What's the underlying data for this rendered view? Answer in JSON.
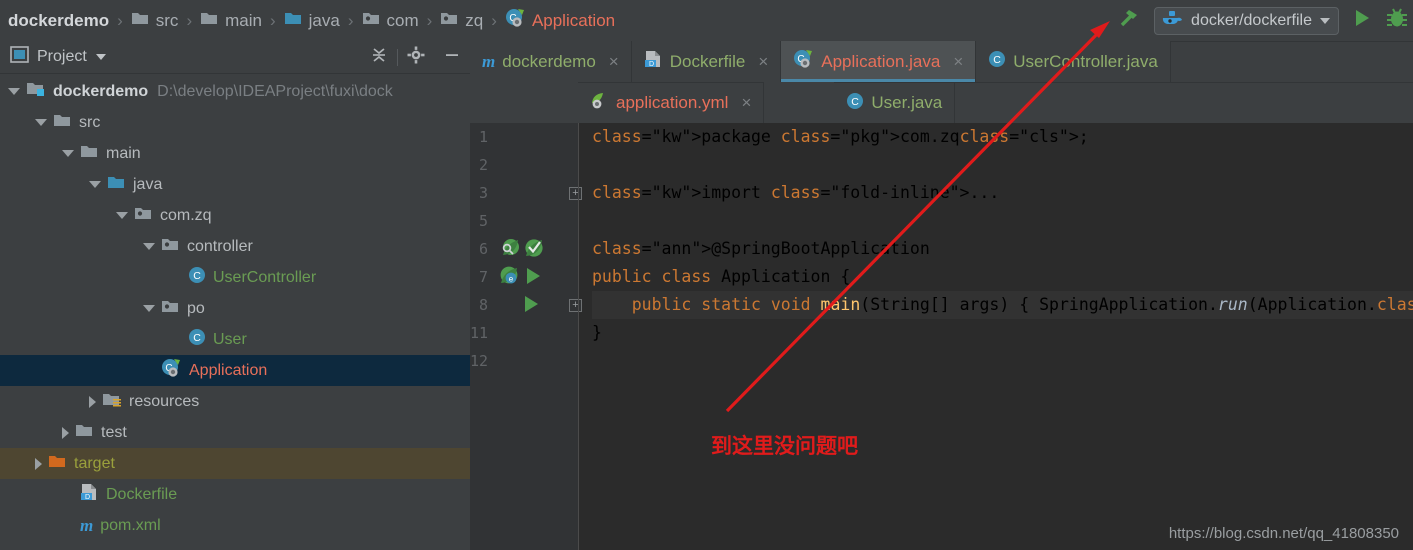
{
  "breadcrumb": {
    "items": [
      {
        "label": "dockerdemo",
        "icon": "none",
        "style": "root"
      },
      {
        "label": "src",
        "icon": "folder-grey",
        "style": "plain"
      },
      {
        "label": "main",
        "icon": "folder-grey",
        "style": "plain"
      },
      {
        "label": "java",
        "icon": "folder-blue",
        "style": "plain"
      },
      {
        "label": "com",
        "icon": "package",
        "style": "plain"
      },
      {
        "label": "zq",
        "icon": "package",
        "style": "plain"
      },
      {
        "label": "Application",
        "icon": "spring-class",
        "style": "leaf"
      }
    ],
    "separator": "›"
  },
  "toolbar": {
    "build_icon": "hammer-icon",
    "run_config": {
      "icon": "docker-whale-icon",
      "label": "docker/dockerfile",
      "caret": "▼"
    },
    "run_icon": "run-icon",
    "debug_icon": "debug-icon"
  },
  "sidebar": {
    "title": "Project",
    "title_icon": "project-view-icon",
    "caret": "▼",
    "actions": [
      {
        "name": "collapse-all-icon",
        "label": ""
      },
      {
        "name": "settings-gear-icon",
        "label": ""
      },
      {
        "name": "hide-panel-icon",
        "label": ""
      }
    ],
    "tree": [
      {
        "label": "dockerdemo",
        "secondary": "D:\\develop\\IDEAProject\\fuxi\\dock",
        "indent": 0,
        "arrow": "open",
        "icon": "module-icon",
        "style": "bold",
        "state": "normal"
      },
      {
        "label": "src",
        "secondary": "",
        "indent": 1,
        "arrow": "open",
        "icon": "folder-grey",
        "style": "plain",
        "state": "normal"
      },
      {
        "label": "main",
        "secondary": "",
        "indent": 2,
        "arrow": "open",
        "icon": "folder-grey",
        "style": "plain",
        "state": "normal"
      },
      {
        "label": "java",
        "secondary": "",
        "indent": 3,
        "arrow": "open",
        "icon": "folder-blue",
        "style": "plain",
        "state": "normal"
      },
      {
        "label": "com.zq",
        "secondary": "",
        "indent": 4,
        "arrow": "open",
        "icon": "package-icon",
        "style": "plain",
        "state": "normal"
      },
      {
        "label": "controller",
        "secondary": "",
        "indent": 5,
        "arrow": "open",
        "icon": "package-icon",
        "style": "plain",
        "state": "normal"
      },
      {
        "label": "UserController",
        "secondary": "",
        "indent": 6,
        "arrow": "none",
        "icon": "java-class-icon",
        "style": "green",
        "state": "normal"
      },
      {
        "label": "po",
        "secondary": "",
        "indent": 5,
        "arrow": "open",
        "icon": "package-icon",
        "style": "plain",
        "state": "normal"
      },
      {
        "label": "User",
        "secondary": "",
        "indent": 6,
        "arrow": "none",
        "icon": "java-class-icon",
        "style": "green",
        "state": "normal"
      },
      {
        "label": "Application",
        "secondary": "",
        "indent": 5,
        "arrow": "none",
        "icon": "spring-class-icon",
        "style": "salmon",
        "state": "selected"
      },
      {
        "label": "resources",
        "secondary": "",
        "indent": 3,
        "arrow": "closed",
        "icon": "resources-folder-icon",
        "style": "plain",
        "state": "normal"
      },
      {
        "label": "test",
        "secondary": "",
        "indent": 2,
        "arrow": "closed",
        "icon": "folder-grey",
        "style": "plain",
        "state": "normal"
      },
      {
        "label": "target",
        "secondary": "",
        "indent": 1,
        "arrow": "closed",
        "icon": "folder-orange",
        "style": "olive",
        "state": "hovered"
      },
      {
        "label": "Dockerfile",
        "secondary": "",
        "indent": 2,
        "arrow": "none",
        "icon": "dockerfile-icon",
        "style": "green",
        "state": "normal"
      },
      {
        "label": "pom.xml",
        "secondary": "",
        "indent": 2,
        "arrow": "none",
        "icon": "maven-icon",
        "style": "green",
        "state": "normal"
      }
    ]
  },
  "editor": {
    "tabs_row1": [
      {
        "label": "dockerdemo",
        "icon": "maven-icon",
        "close": "×",
        "active": false,
        "color": "green"
      },
      {
        "label": "Dockerfile",
        "icon": "dockerfile-icon",
        "close": "×",
        "active": false,
        "color": "green"
      },
      {
        "label": "Application.java",
        "icon": "spring-class-icon",
        "close": "×",
        "active": true,
        "color": "salmon"
      },
      {
        "label": "UserController.java",
        "icon": "java-class-icon",
        "close": "",
        "active": false,
        "color": "green"
      }
    ],
    "tabs_row2": [
      {
        "label": "application.yml",
        "icon": "spring-yml-icon",
        "close": "×",
        "active": false,
        "color": "salmon"
      },
      {
        "label": "User.java",
        "icon": "java-class-icon",
        "close": "",
        "active": false,
        "color": "green"
      }
    ],
    "line_numbers": [
      "1",
      "2",
      "3",
      "5",
      "6",
      "7",
      "8",
      "11",
      "12"
    ],
    "gutter_icons": {
      "line6": [
        "spring-search-icon",
        "spring-check-icon"
      ],
      "line7": [
        "spring-bean-icon",
        "run-icon"
      ],
      "line8": [
        "run-icon"
      ]
    },
    "fold_markers": {
      "line3": "+",
      "line8": "+"
    },
    "code_lines": [
      {
        "num": "1",
        "text": "package com.zq;"
      },
      {
        "num": "2",
        "text": ""
      },
      {
        "num": "3",
        "text": "import ..."
      },
      {
        "num": "5",
        "text": ""
      },
      {
        "num": "6",
        "text": "@SpringBootApplication"
      },
      {
        "num": "7",
        "text": "public class Application {"
      },
      {
        "num": "8",
        "text": "    public static void main(String[] args) { SpringApplication.run(Application.class, args);"
      },
      {
        "num": "11",
        "text": "}"
      },
      {
        "num": "12",
        "text": ""
      }
    ],
    "watermark": "https://blog.csdn.net/qq_41808350"
  },
  "annotations": {
    "arrow_color": "#e01b1b",
    "note_text": "到这里没问题吧"
  },
  "colors": {
    "background": "#3c3f41",
    "editor_bg": "#2b2b2b",
    "selection": "#0d293e",
    "hover": "#4e4631",
    "accent_blue": "#4a88a8",
    "salmon": "#e8705a",
    "green_text": "#6a9c53",
    "annotation_red": "#e01b1b"
  }
}
